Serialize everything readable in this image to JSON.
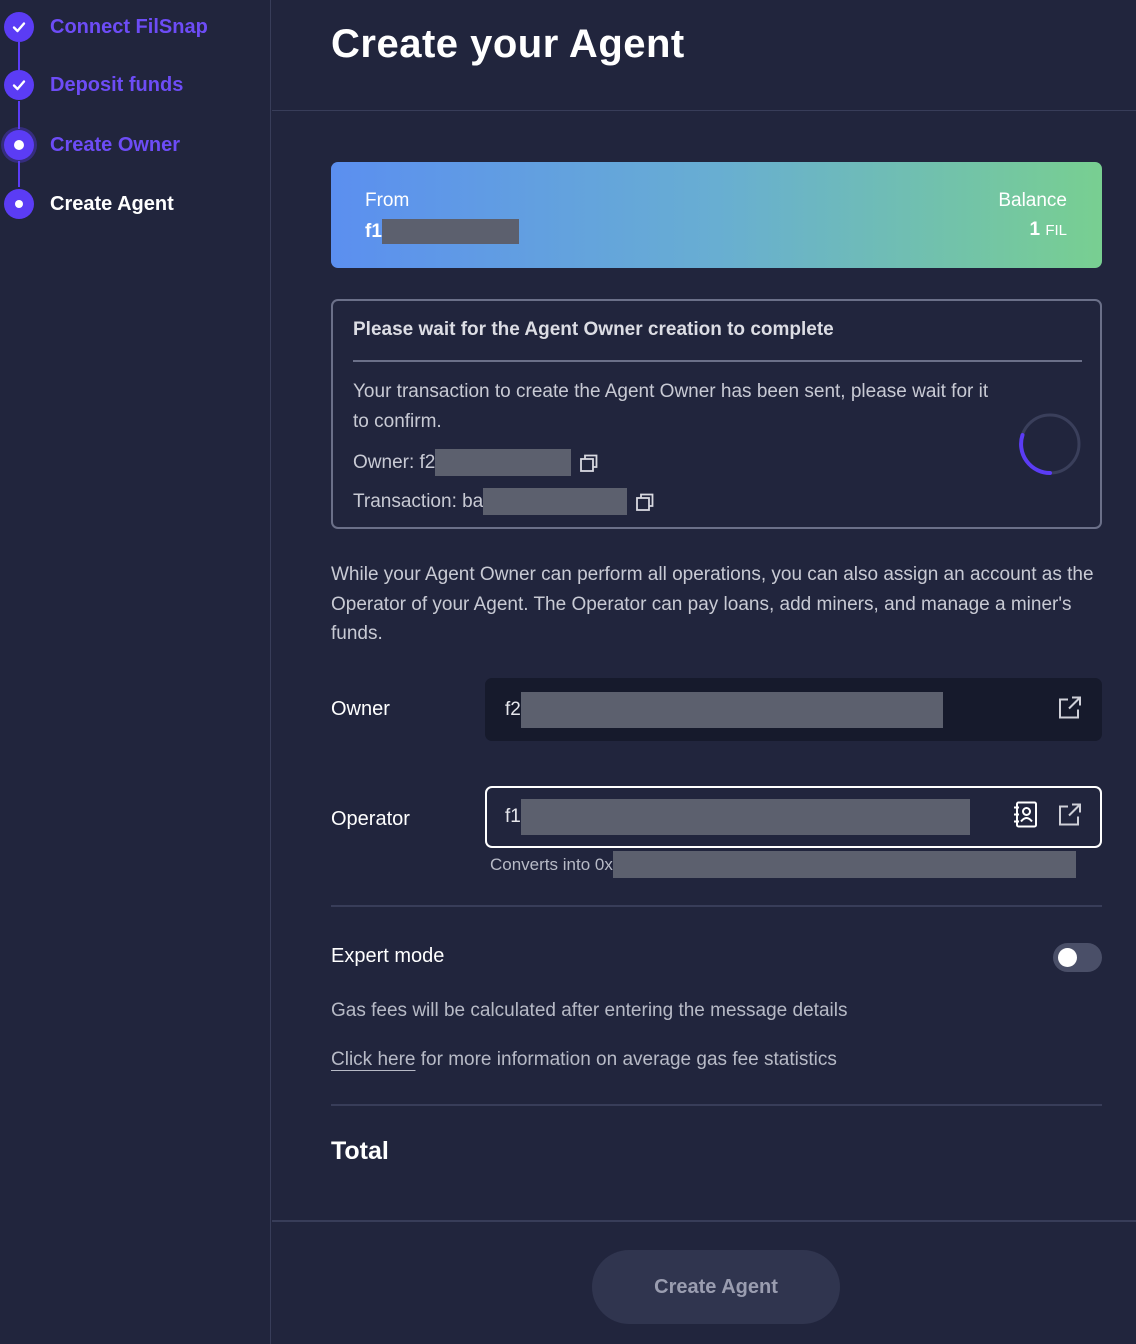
{
  "sidebar": {
    "steps": [
      {
        "label": "Connect FilSnap",
        "state": "done"
      },
      {
        "label": "Deposit funds",
        "state": "done"
      },
      {
        "label": "Create Owner",
        "state": "in-progress"
      },
      {
        "label": "Create Agent",
        "state": "current"
      }
    ]
  },
  "header": {
    "title": "Create your Agent"
  },
  "from_card": {
    "from_label": "From",
    "from_address_prefix": "f1",
    "balance_label": "Balance",
    "balance_value": "1",
    "balance_unit": "FIL"
  },
  "wait_box": {
    "title": "Please wait for the Agent Owner creation to complete",
    "message": "Your transaction to create the Agent Owner has been sent, please wait for it to confirm.",
    "owner_label": "Owner: f2",
    "transaction_label": "Transaction: ba"
  },
  "description": "While your Agent Owner can perform all operations, you can also assign an account as the Operator of your Agent. The Operator can pay loans, add miners, and manage a miner's funds.",
  "owner_field": {
    "label": "Owner",
    "value_prefix": "f2"
  },
  "operator_field": {
    "label": "Operator",
    "value_prefix": "f1",
    "converts_prefix": "Converts into 0x"
  },
  "expert_mode": {
    "label": "Expert mode",
    "enabled": false
  },
  "gas_text": "Gas fees will be calculated after entering the message details",
  "info": {
    "link_text": "Click here",
    "rest_text": " for more information on average gas fee statistics"
  },
  "total_label": "Total",
  "create_button_label": "Create Agent",
  "colors": {
    "background": "#21253d",
    "accent": "#5b3cf5",
    "field_dark": "#161a2c",
    "button_disabled": "#30354f"
  }
}
